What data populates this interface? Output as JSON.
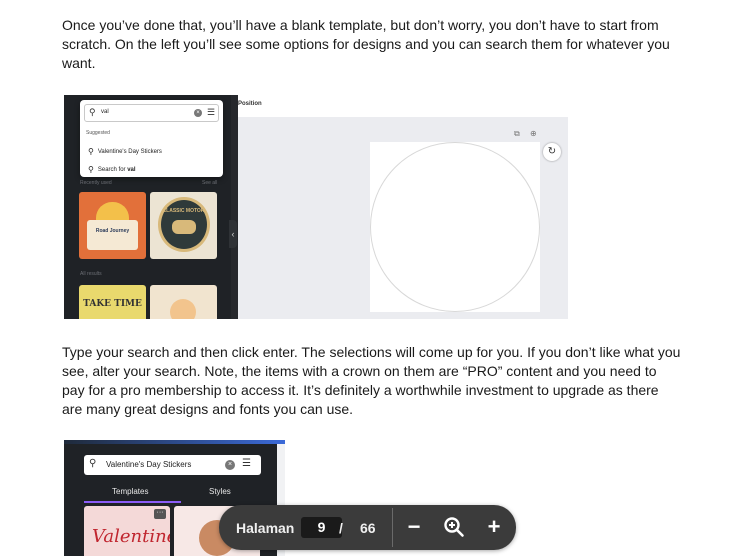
{
  "paragraphs": {
    "p1": "Once you’ve done that, you’ll have a blank template, but don’t worry, you don’t have to start from scratch. On the left you’ll see some options for designs and you can search them for whatever you want.",
    "p2": "Type your search and then click enter. The selections will come up for you. If you don’t like what you see, alter your search. Note, the items with a crown on them are “PRO” content and you need to pay for a pro membership to access it. It’s definitely a worthwhile investment to upgrade as there are many great designs and fonts you can use."
  },
  "screenshot1": {
    "search_value": "val",
    "suggested_label": "Suggested",
    "suggestion_1": "Valentine's Day Stickers",
    "suggestion_2_prefix": "Search for ",
    "suggestion_2_term": "val",
    "recently_used": "Recently used",
    "see_all": "See all",
    "all_results": "All results",
    "position_label": "Position",
    "thumb1_text": "Road Journey",
    "thumb2_text": "CLASSIC MOTOR",
    "thumb3_text": "TAKE TIME"
  },
  "screenshot2": {
    "search_value": "Valentine's Day Stickers",
    "tab_templates": "Templates",
    "tab_styles": "Styles",
    "card1_text": "Valentine"
  },
  "pager": {
    "label": "Halaman",
    "current_page": "9",
    "separator": "/",
    "total_pages": "66"
  },
  "icons": {
    "zoom_out": "minus-icon",
    "zoom": "zoom-icon",
    "zoom_in": "plus-icon"
  }
}
